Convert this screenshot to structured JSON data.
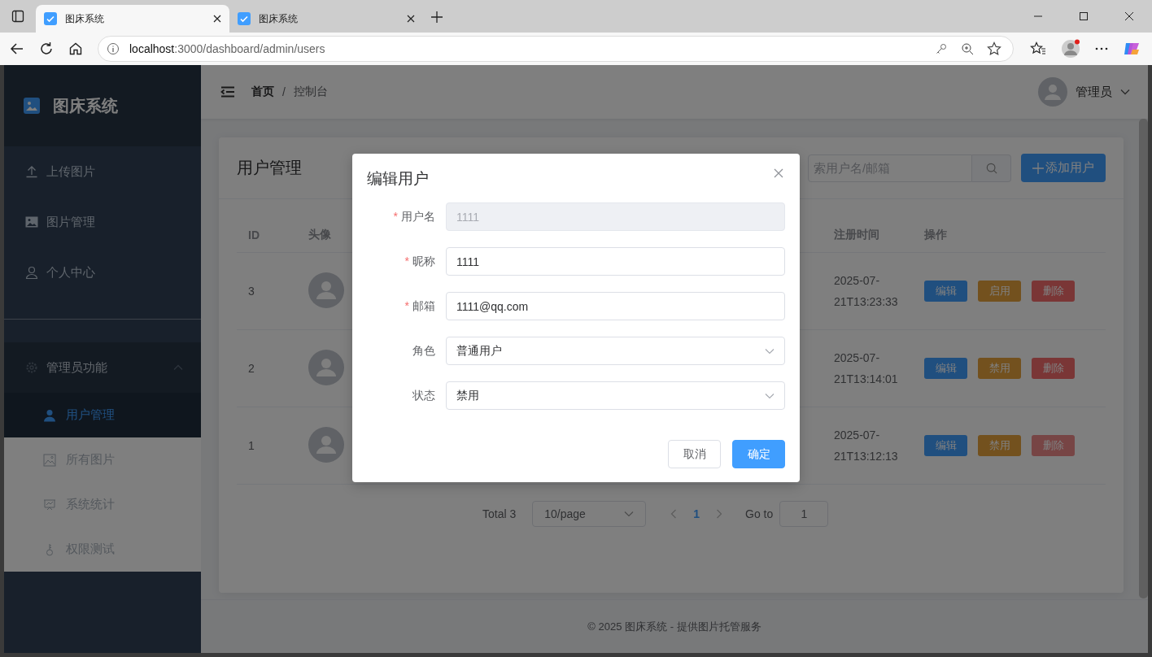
{
  "browser": {
    "tabs": [
      {
        "title": "图床系统",
        "selected": true
      },
      {
        "title": "图床系统",
        "selected": false
      }
    ],
    "url_host": "localhost",
    "url_path": ":3000/dashboard/admin/users"
  },
  "sidebar": {
    "title": "图床系统",
    "items": [
      {
        "label": "上传图片",
        "kind": "upload"
      },
      {
        "label": "图片管理",
        "kind": "image"
      },
      {
        "label": "个人中心",
        "kind": "person"
      }
    ],
    "group": {
      "label": "管理员功能",
      "expanded": true,
      "children": [
        {
          "label": "用户管理",
          "kind": "person",
          "selected": true
        },
        {
          "label": "所有图片",
          "kind": "picture",
          "selected": false
        },
        {
          "label": "系统统计",
          "kind": "chart",
          "selected": false
        },
        {
          "label": "权限测试",
          "kind": "key",
          "selected": false
        }
      ]
    }
  },
  "header": {
    "breadcrumb": [
      "首页",
      "控制台"
    ],
    "separator": "/",
    "user": "管理员"
  },
  "card": {
    "title": "用户管理",
    "search": {
      "placeholder": "索用户名/邮箱"
    },
    "add_button": "添加用户"
  },
  "table": {
    "columns": [
      "ID",
      "头像",
      "注册时间",
      "操作"
    ],
    "rows": [
      {
        "id": "3",
        "registered": "2025-07-21T13:23:33",
        "actions": [
          {
            "label": "编辑",
            "kind": "edit",
            "disabled": false
          },
          {
            "label": "启用",
            "kind": "toggle",
            "disabled": false
          },
          {
            "label": "删除",
            "kind": "delete",
            "disabled": false
          }
        ]
      },
      {
        "id": "2",
        "registered": "2025-07-21T13:14:01",
        "actions": [
          {
            "label": "编辑",
            "kind": "edit",
            "disabled": false
          },
          {
            "label": "禁用",
            "kind": "toggle",
            "disabled": false
          },
          {
            "label": "删除",
            "kind": "delete",
            "disabled": false
          }
        ]
      },
      {
        "id": "1",
        "registered": "2025-07-21T13:12:13",
        "actions": [
          {
            "label": "编辑",
            "kind": "edit",
            "disabled": false
          },
          {
            "label": "禁用",
            "kind": "toggle",
            "disabled": false
          },
          {
            "label": "删除",
            "kind": "delete",
            "disabled": true
          }
        ]
      }
    ]
  },
  "pagination": {
    "total": "Total 3",
    "page_size": "10/page",
    "pages": [
      {
        "label": "1",
        "selected": true
      }
    ],
    "goto_label": "Go to",
    "goto_value": "1"
  },
  "footer": "© 2025 图床系统 - 提供图片托管服务",
  "dialog": {
    "title": "编辑用户",
    "required_mark": "*",
    "fields": [
      {
        "label": "用户名",
        "required": true,
        "value": "1111",
        "disabled": true,
        "kind": "input"
      },
      {
        "label": "昵称",
        "required": true,
        "value": "1111",
        "disabled": false,
        "kind": "input"
      },
      {
        "label": "邮箱",
        "required": true,
        "value": "1111@qq.com",
        "disabled": false,
        "kind": "input"
      },
      {
        "label": "角色",
        "required": false,
        "value": "普通用户",
        "kind": "select"
      },
      {
        "label": "状态",
        "required": false,
        "value": "禁用",
        "kind": "select"
      }
    ],
    "buttons": [
      {
        "label": "取消",
        "kind": "secondary"
      },
      {
        "label": "确定",
        "kind": "primary"
      }
    ]
  }
}
